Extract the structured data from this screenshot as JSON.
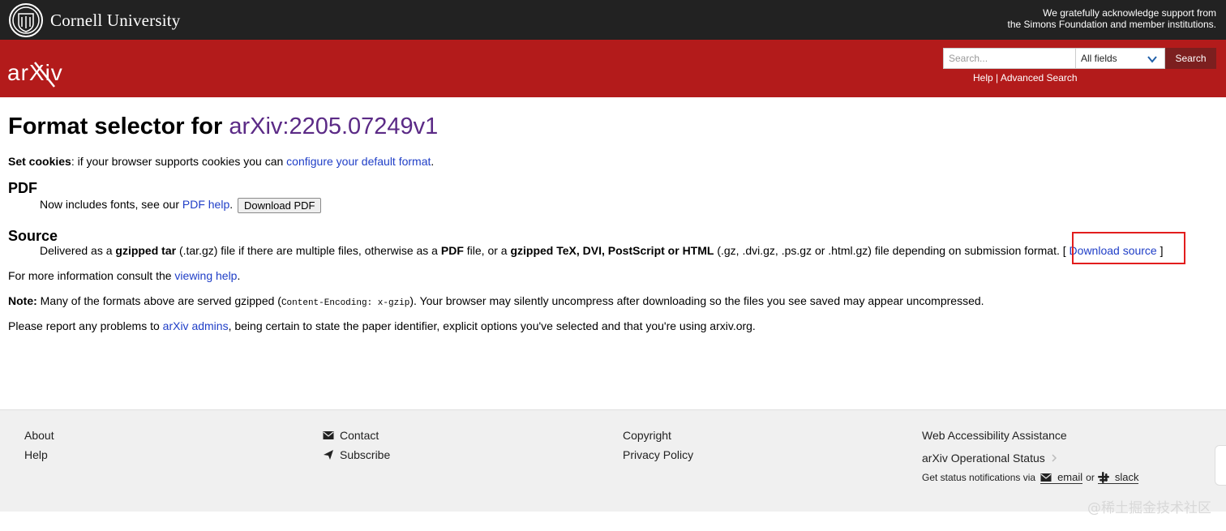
{
  "cornell": {
    "name": "Cornell University",
    "support_line1": "We gratefully acknowledge support from",
    "support_line2": "the Simons Foundation and member institutions."
  },
  "header": {
    "logo_text": "arXiv",
    "search_placeholder": "Search...",
    "field_select_value": "All fields",
    "search_button": "Search",
    "help_link": "Help",
    "separator": " | ",
    "advanced_search_link": "Advanced Search"
  },
  "main": {
    "title_prefix": "Format selector for ",
    "paper_id": "arXiv:2205.07249v1",
    "cookies_label": "Set cookies",
    "cookies_text": ": if your browser supports cookies you can ",
    "cookies_link": "configure your default format",
    "cookies_end": ".",
    "pdf_heading": "PDF",
    "pdf_text": "Now includes fonts, see our ",
    "pdf_help_link": "PDF help",
    "pdf_text_end": ".",
    "download_pdf_button": "Download PDF",
    "source_heading": "Source",
    "source_t1": "Delivered as a ",
    "source_b1": "gzipped tar",
    "source_t2": " (.tar.gz) file if there are multiple files, otherwise as a ",
    "source_b2": "PDF",
    "source_t3": " file, or a ",
    "source_b3": "gzipped TeX, DVI, PostScript or HTML",
    "source_t4": " (.gz, .dvi.gz, .ps.gz or .html.gz) file depending on submission format.",
    "bracket_open": " [ ",
    "download_source_link": "Download source",
    "bracket_close": " ]",
    "more_info_text": "For more information consult the ",
    "viewing_help_link": "viewing help",
    "more_info_end": ".",
    "note_label": "Note:",
    "note_t1": " Many of the formats above are served gzipped (",
    "note_code": "Content-Encoding: x-gzip",
    "note_t2": "). Your browser may silently uncompress after downloading so the files you see saved may appear uncompressed.",
    "report_t1": "Please report any problems to ",
    "report_link": "arXiv admins",
    "report_t2": ", being certain to state the paper identifier, explicit options you've selected and that you're using arxiv.org."
  },
  "footer": {
    "about": "About",
    "help": "Help",
    "contact": "Contact",
    "subscribe": "Subscribe",
    "copyright": "Copyright",
    "privacy": "Privacy Policy",
    "accessibility": "Web Accessibility Assistance",
    "operational_status": "arXiv Operational Status",
    "status_notice": "Get status notifications via",
    "email": "email",
    "or": "or",
    "slack": "slack"
  },
  "watermark": "@稀土掘金技术社区",
  "colors": {
    "cornell_bar": "#222222",
    "arxiv_red": "#b31b1b",
    "search_button": "#7c1f1f",
    "link": "#1a0dab",
    "paper_id": "#5b2a86",
    "highlight_box": "#e21d1d"
  }
}
